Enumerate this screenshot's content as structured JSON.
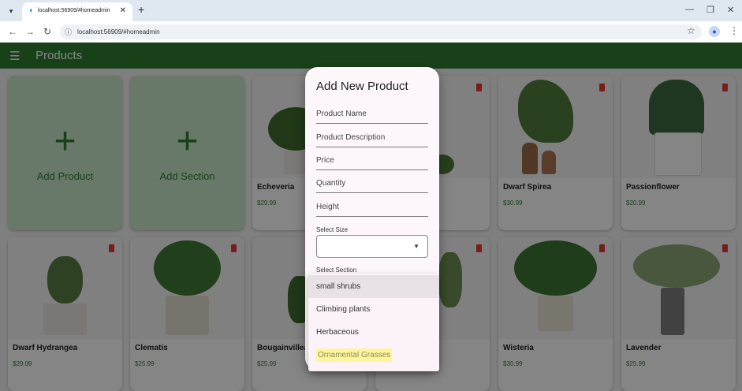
{
  "browser": {
    "tab_title": "localhost:56909/#homeadmin",
    "url": "localhost:56909/#homeadmin"
  },
  "app": {
    "title": "Products",
    "action_cards": [
      {
        "label": "Add Product"
      },
      {
        "label": "Add Section"
      }
    ],
    "products_row1": [
      {
        "name": "Echeveria",
        "price": "$29.99"
      },
      {
        "name": "Dwarf Spirea",
        "price": "$30.99"
      },
      {
        "name": "Passionflower",
        "price": "$20.99"
      }
    ],
    "products_row2": [
      {
        "name": "Dwarf Hydrangea",
        "price": "$29.99"
      },
      {
        "name": "Clematis",
        "price": "$25.99"
      },
      {
        "name": "Bougainvillea",
        "price": "$25.99"
      },
      {
        "name": "Wisteria",
        "price": "$30.99"
      },
      {
        "name": "Lavender",
        "price": "$25.99"
      }
    ]
  },
  "dialog": {
    "title": "Add New Product",
    "fields": [
      "Product Name",
      "Product Description",
      "Price",
      "Quantity",
      "Height"
    ],
    "select_size_label": "Select Size",
    "select_section_label": "Select Section",
    "section_options": [
      "small shrubs",
      "Climbing plants",
      "Herbaceous",
      "Ornamental Grasses"
    ]
  },
  "colors": {
    "appbar": "#2e7d32",
    "accent_green": "#2e7d32",
    "delete_red": "#e53935",
    "highlight": "#fff59d"
  }
}
